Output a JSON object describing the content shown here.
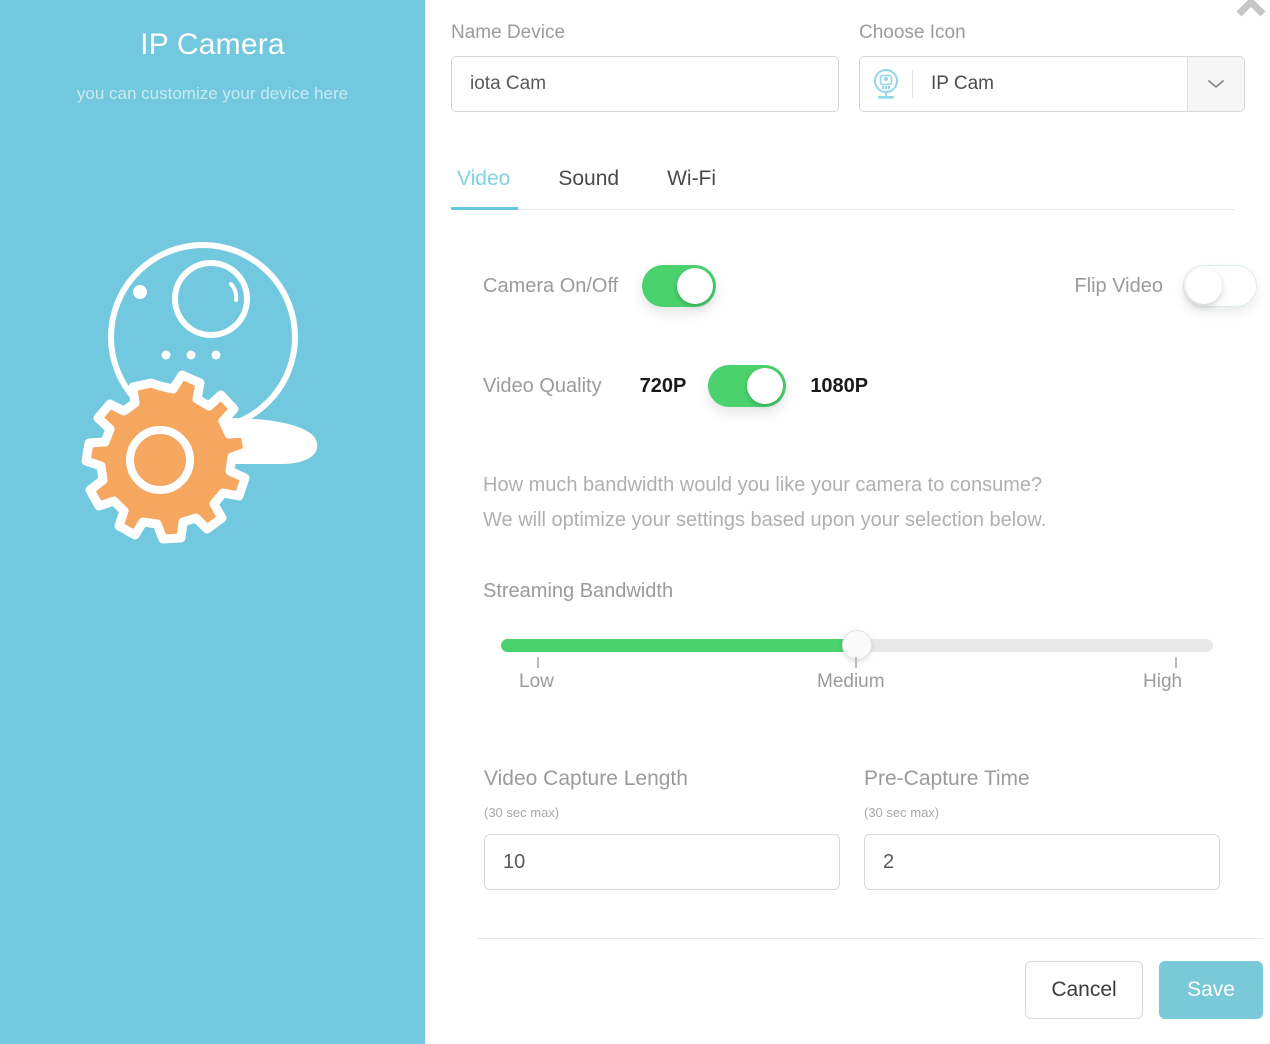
{
  "sidebar": {
    "title": "IP Camera",
    "subtitle": "you can customize your device here",
    "illustration_name": "ip-camera-gear-illustration",
    "background_color": "#72c8de",
    "gear_color": "#f5a75f"
  },
  "close_icon": "close-icon",
  "form": {
    "name_device": {
      "label": "Name Device",
      "value": "iota Cam",
      "placeholder": "Name Device"
    },
    "choose_icon": {
      "label": "Choose Icon",
      "value": "IP Cam",
      "icon": "ip-camera-icon",
      "caret": "chevron-down-icon"
    }
  },
  "tabs": [
    {
      "label": "Video",
      "active": true
    },
    {
      "label": "Sound",
      "active": false
    },
    {
      "label": "Wi-Fi",
      "active": false
    }
  ],
  "video": {
    "camera_toggle": {
      "label": "Camera On/Off",
      "state": "on"
    },
    "flip_toggle": {
      "label": "Flip Video",
      "state": "off"
    },
    "quality": {
      "label": "Video Quality",
      "option_left": "720P",
      "option_right": "1080P",
      "state": "on"
    },
    "bandwidth_desc_line1": "How much bandwidth would you like your camera to consume?",
    "bandwidth_desc_line2": "We will optimize your settings based upon your selection below.",
    "slider": {
      "label": "Streaming Bandwidth",
      "ticks": [
        "Low",
        "Medium",
        "High"
      ],
      "value_percent": 50,
      "selected": "Medium"
    },
    "capture_length": {
      "title": "Video Capture Length",
      "hint": "(30 sec max)",
      "value": "10"
    },
    "pre_capture": {
      "title": "Pre-Capture Time",
      "hint": "(30 sec max)",
      "value": "2"
    }
  },
  "footer": {
    "cancel_label": "Cancel",
    "save_label": "Save"
  },
  "colors": {
    "accent_teal": "#72c8de",
    "toggle_green": "#4ad26d",
    "edge_green": "#25a163",
    "gear_orange": "#f5a75f"
  }
}
